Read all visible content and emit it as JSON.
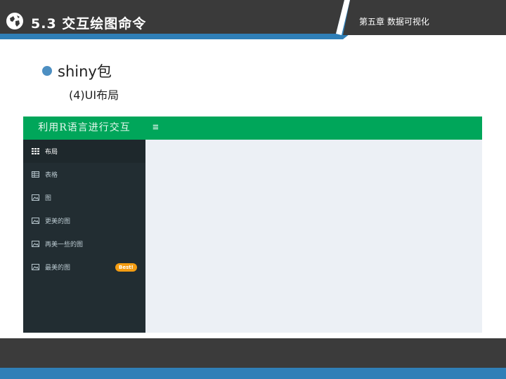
{
  "slide": {
    "title": "5.3 交互绘图命令",
    "chapter": "第五章 数据可视化",
    "bullet": "shiny包",
    "subheading": "(4)UI布局"
  },
  "app": {
    "brand": "利用R语言进行交互",
    "menu_icon": "hamburger-icon",
    "nav": [
      {
        "label": "布局",
        "icon": "th-icon",
        "active": true
      },
      {
        "label": "表格",
        "icon": "table-icon"
      },
      {
        "label": "图",
        "icon": "image-icon"
      },
      {
        "label": "更美的图",
        "icon": "image-icon"
      },
      {
        "label": "再美一些的图",
        "icon": "image-icon"
      },
      {
        "label": "最美的图",
        "icon": "image-icon",
        "badge": "Best!"
      }
    ]
  },
  "colors": {
    "header_bg": "#3a3a3a",
    "header_accent": "#2f7fb7",
    "brand_green": "#00a65a",
    "sidebar": "#222d32",
    "content_bg": "#ecf0f5",
    "badge": "#f39c12"
  }
}
